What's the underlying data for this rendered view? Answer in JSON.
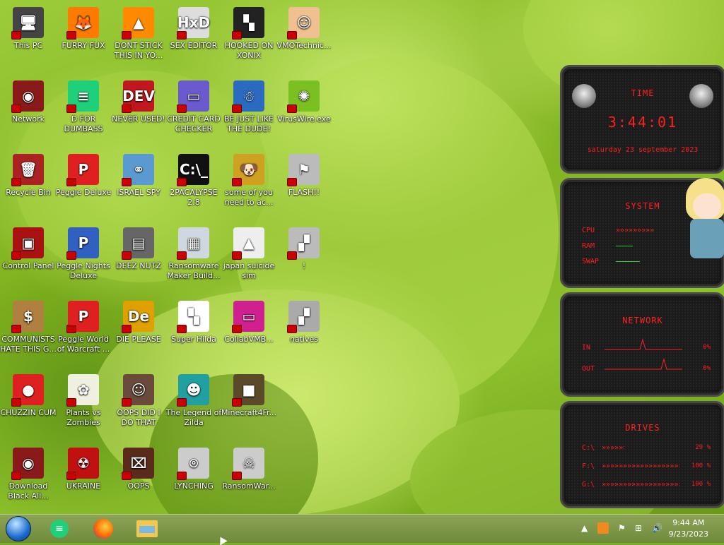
{
  "desktop": {
    "icons": [
      {
        "label": "This PC",
        "color": "#444",
        "glyph": "🖥"
      },
      {
        "label": "FURRY FUX",
        "color": "#ff7a00",
        "glyph": "🦊"
      },
      {
        "label": "DONT STICK THIS IN YO...",
        "color": "#ff8a00",
        "glyph": "▲"
      },
      {
        "label": "SEX EDITOR",
        "color": "#ddd",
        "glyph": "HxD"
      },
      {
        "label": "HOOKED ON XONIX",
        "color": "#222",
        "glyph": "▚"
      },
      {
        "label": "VMOTechnic...",
        "color": "#f0c090",
        "glyph": "☺"
      },
      {
        "label": "Network",
        "color": "#8a1a1a",
        "glyph": "◉"
      },
      {
        "label": "D FOR DUMBASS",
        "color": "#1fd07a",
        "glyph": "≡"
      },
      {
        "label": "NEVER USED!",
        "color": "#c0181e",
        "glyph": "DEV"
      },
      {
        "label": "CREDIT CARD CHECKER",
        "color": "#6a5acd",
        "glyph": "▭"
      },
      {
        "label": "BE JUST LIKE THE DUDE!",
        "color": "#2a6ac0",
        "glyph": "☃"
      },
      {
        "label": "VirusWire.exe",
        "color": "#7ac020",
        "glyph": "✺"
      },
      {
        "label": "Recycle Bin",
        "color": "#aa2222",
        "glyph": "🗑"
      },
      {
        "label": "Peggle Deluxe",
        "color": "#e02020",
        "glyph": "P"
      },
      {
        "label": "ISRAEL SPY",
        "color": "#5a9ad0",
        "glyph": "⚭"
      },
      {
        "label": "2PACALYPSE 2.8",
        "color": "#111",
        "glyph": "C:\\_"
      },
      {
        "label": "some of you need to ac...",
        "color": "#d0a020",
        "glyph": "🐶"
      },
      {
        "label": "FLASH!!",
        "color": "#bbb",
        "glyph": "⚑"
      },
      {
        "label": "Control Panel",
        "color": "#aa1111",
        "glyph": "▣"
      },
      {
        "label": "Peggle Nights Deluxe",
        "color": "#3060c0",
        "glyph": "P"
      },
      {
        "label": "DEEZ NUTZ",
        "color": "#666",
        "glyph": "▤"
      },
      {
        "label": "Ransomware Maker Build...",
        "color": "#cfd8e0",
        "glyph": "▦"
      },
      {
        "label": "japan suicide sim",
        "color": "#eee",
        "glyph": "▲"
      },
      {
        "label": "!",
        "color": "#bbb",
        "glyph": "▞"
      },
      {
        "label": "COMMUNISTS HATE THIS G...",
        "color": "#b08040",
        "glyph": "$"
      },
      {
        "label": "Peggle World of Warcraft ...",
        "color": "#e02020",
        "glyph": "P"
      },
      {
        "label": "DIE PLEASE",
        "color": "#e0a000",
        "glyph": "De"
      },
      {
        "label": "Super Hilda",
        "color": "#fff",
        "glyph": "▚"
      },
      {
        "label": "CollabVMB...",
        "color": "#d02090",
        "glyph": "▭"
      },
      {
        "label": "natives",
        "color": "#aaa",
        "glyph": "▞"
      },
      {
        "label": "CHUZZIN CUM",
        "color": "#e02020",
        "glyph": "●"
      },
      {
        "label": "Plants vs Zombies",
        "color": "#f0f0e0",
        "glyph": "✿"
      },
      {
        "label": "OOPS DID I DO THAT",
        "color": "#6a4a3a",
        "glyph": "☺"
      },
      {
        "label": "The Legend of Zilda",
        "color": "#20a0a0",
        "glyph": "☻"
      },
      {
        "label": "Minecraft4Fr...",
        "color": "#5a4a2a",
        "glyph": "■"
      },
      {
        "label": "Download Black Ali...",
        "color": "#8a1a1a",
        "glyph": "◉"
      },
      {
        "label": "UKRAINE",
        "color": "#c01010",
        "glyph": "☢"
      },
      {
        "label": "OOPS",
        "color": "#5a2a1a",
        "glyph": "⌧"
      },
      {
        "label": "LYNCHING",
        "color": "#ccc",
        "glyph": "⌾"
      },
      {
        "label": "RansomWar...",
        "color": "#ccc",
        "glyph": "☠"
      }
    ]
  },
  "widget": {
    "time_title": "TIME",
    "time_value": "3:44:01",
    "date_value": "saturday 23 september 2023",
    "system_title": "SYSTEM",
    "cpu_label": "CPU",
    "ram_label": "RAM",
    "swap_label": "SWAP",
    "network_title": "NETWORK",
    "in_label": "IN",
    "in_value": "0%",
    "out_label": "OUT",
    "out_value": "0%",
    "drives_title": "DRIVES",
    "drives": [
      {
        "label": "C:\\",
        "value": "29 %",
        "fill": 0.29
      },
      {
        "label": "F:\\",
        "value": "100 %",
        "fill": 1.0
      },
      {
        "label": "G:\\",
        "value": "100 %",
        "fill": 1.0
      }
    ]
  },
  "taskbar": {
    "time": "9:44 AM",
    "date": "9/23/2023"
  }
}
